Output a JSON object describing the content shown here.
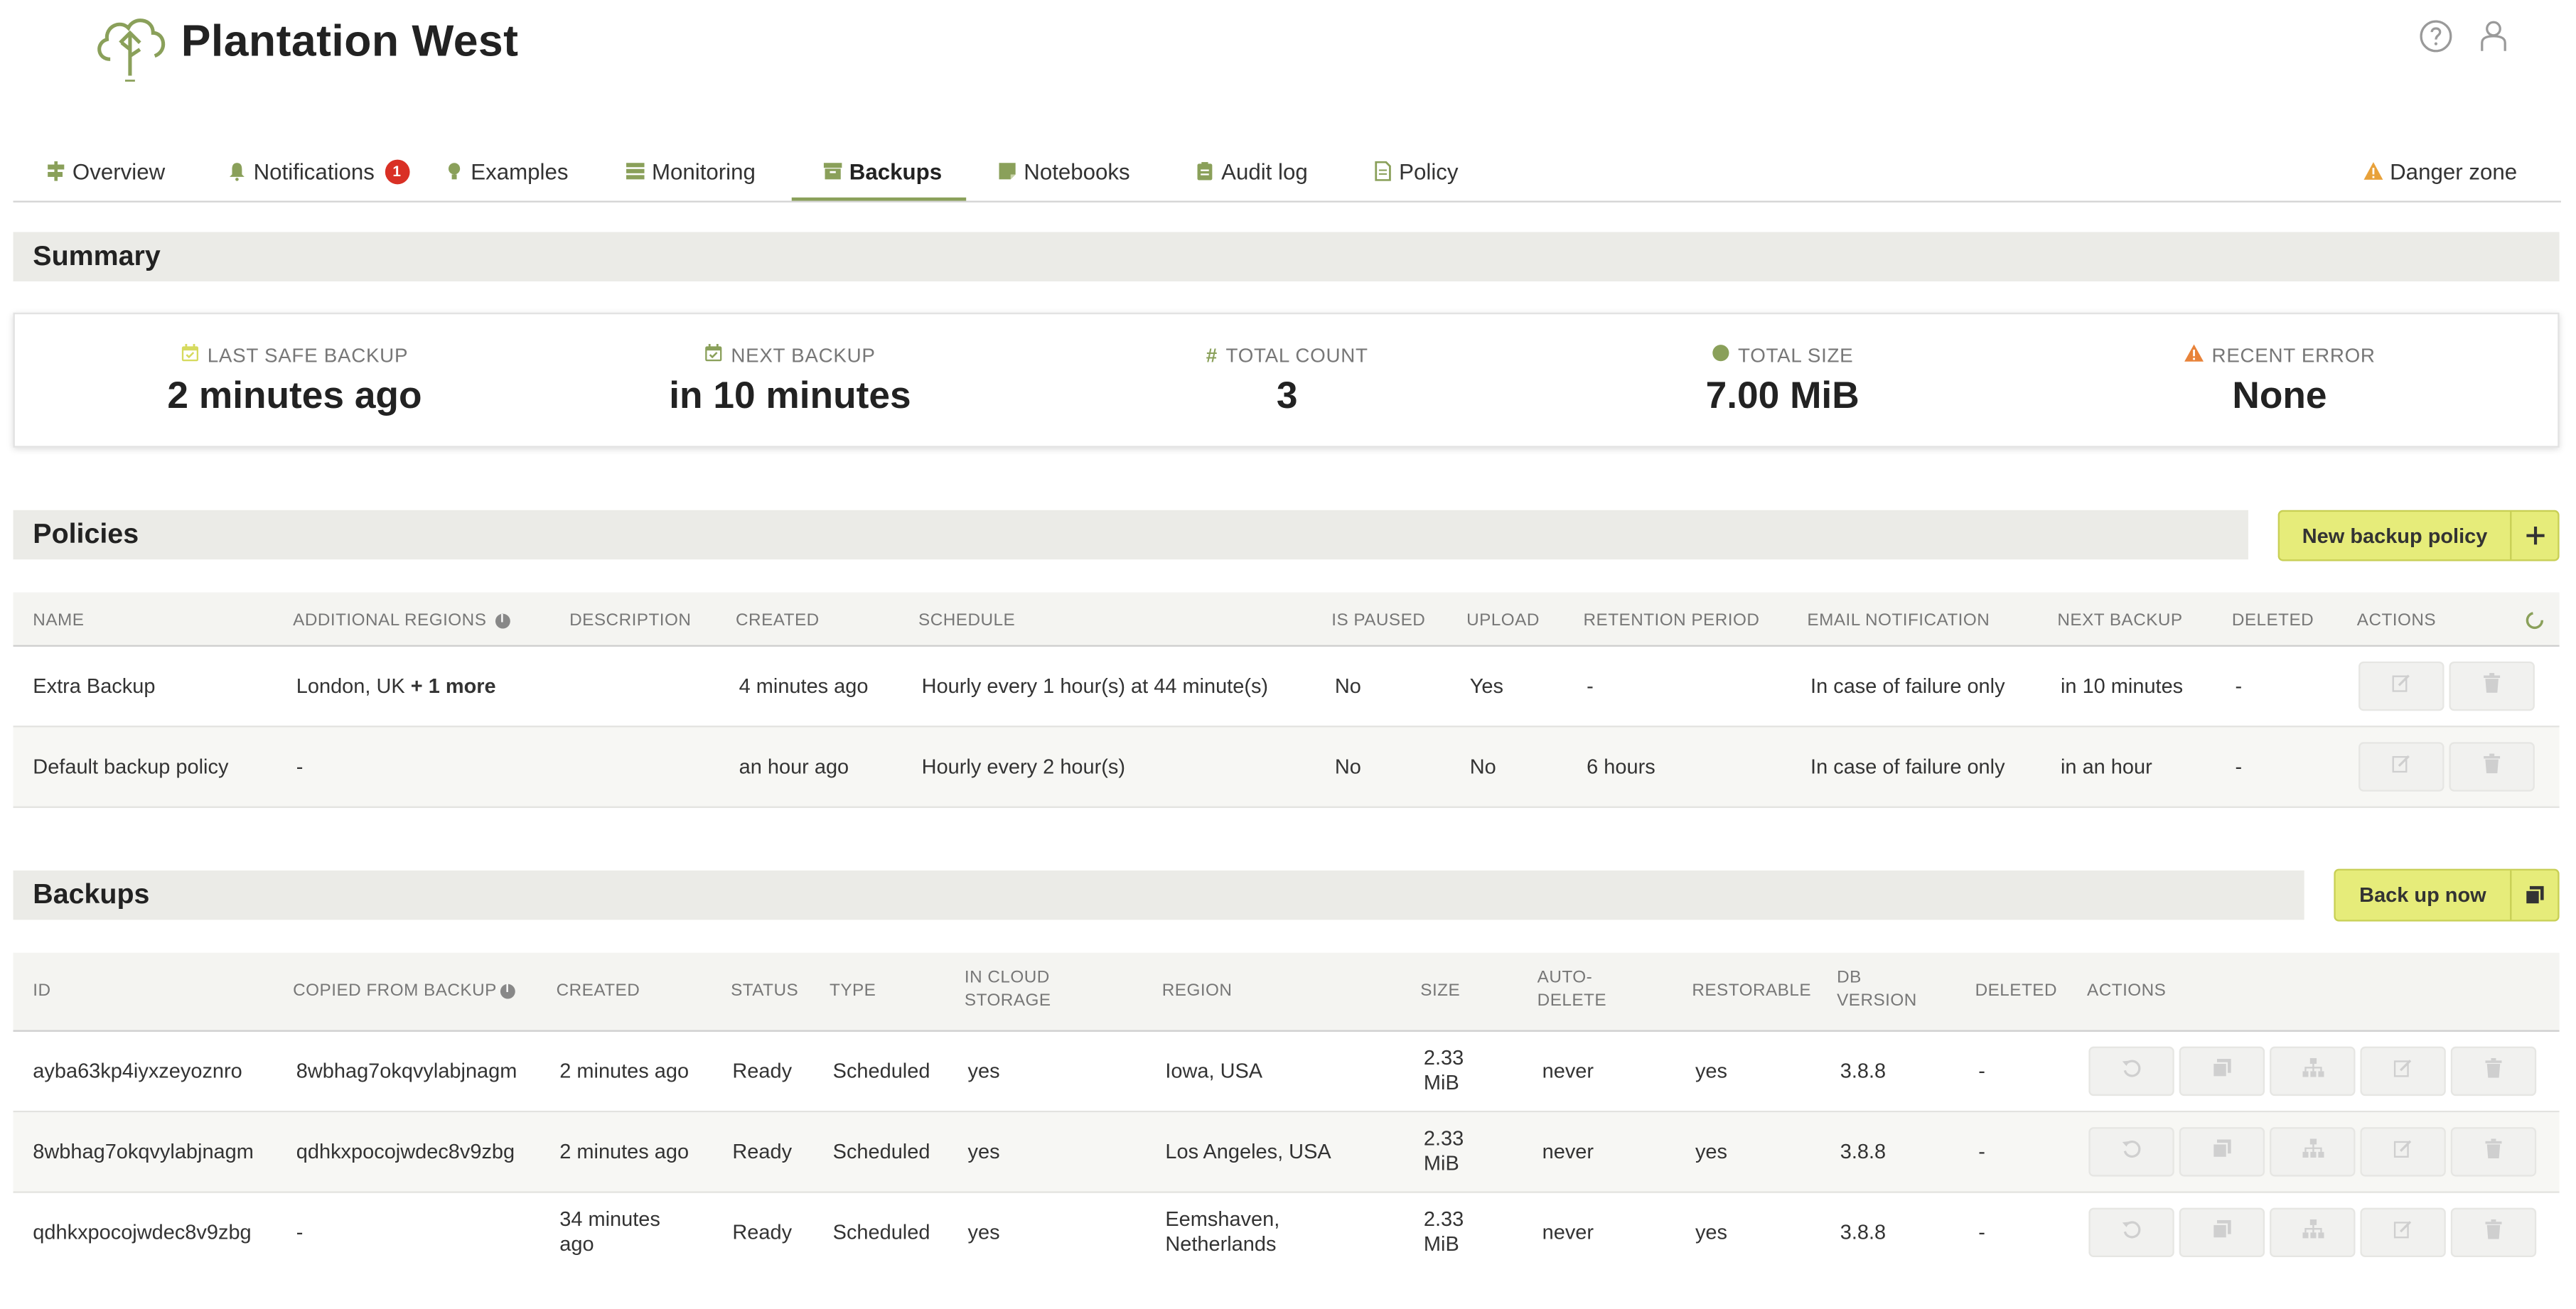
{
  "app": {
    "title": "Plantation West"
  },
  "tabs": [
    {
      "label": "Overview",
      "icon": "signpost-icon"
    },
    {
      "label": "Notifications",
      "icon": "bell-icon",
      "badge": "1"
    },
    {
      "label": "Examples",
      "icon": "lightbulb-icon"
    },
    {
      "label": "Monitoring",
      "icon": "server-icon"
    },
    {
      "label": "Backups",
      "icon": "archive-icon",
      "active": true
    },
    {
      "label": "Notebooks",
      "icon": "notebook-icon"
    },
    {
      "label": "Audit log",
      "icon": "clipboard-icon"
    },
    {
      "label": "Policy",
      "icon": "document-icon"
    },
    {
      "label": "Danger zone",
      "icon": "warning-icon"
    }
  ],
  "summary": {
    "title": "Summary",
    "stats": [
      {
        "label": "LAST SAFE BACKUP",
        "value": "2 minutes ago"
      },
      {
        "label": "NEXT BACKUP",
        "value": "in 10 minutes"
      },
      {
        "label": "TOTAL COUNT",
        "value": "3"
      },
      {
        "label": "TOTAL SIZE",
        "value": "7.00 MiB"
      },
      {
        "label": "RECENT ERROR",
        "value": "None"
      }
    ]
  },
  "policies": {
    "title": "Policies",
    "new_button": "New backup policy",
    "columns": [
      "NAME",
      "ADDITIONAL REGIONS",
      "DESCRIPTION",
      "CREATED",
      "SCHEDULE",
      "IS PAUSED",
      "UPLOAD",
      "RETENTION PERIOD",
      "EMAIL NOTIFICATION",
      "NEXT BACKUP",
      "DELETED",
      "ACTIONS"
    ],
    "rows": [
      {
        "name": "Extra Backup",
        "regions": "London, UK",
        "regions_more": "+ 1 more",
        "description": "",
        "created": "4 minutes ago",
        "schedule": "Hourly every 1 hour(s) at 44 minute(s)",
        "paused": "No",
        "upload": "Yes",
        "retention": "-",
        "email": "In case of failure only",
        "next": "in 10 minutes",
        "deleted": "-"
      },
      {
        "name": "Default backup policy",
        "regions": "-",
        "regions_more": "",
        "description": "",
        "created": "an hour ago",
        "schedule": "Hourly every 2 hour(s)",
        "paused": "No",
        "upload": "No",
        "retention": "6 hours",
        "email": "In case of failure only",
        "next": "in an hour",
        "deleted": "-"
      }
    ]
  },
  "backups": {
    "title": "Backups",
    "backup_button": "Back up now",
    "columns": [
      "ID",
      "COPIED FROM BACKUP",
      "CREATED",
      "STATUS",
      "TYPE",
      "IN CLOUD STORAGE",
      "REGION",
      "SIZE",
      "AUTO-DELETE",
      "RESTORABLE",
      "DB VERSION",
      "DELETED",
      "ACTIONS"
    ],
    "rows": [
      {
        "id": "ayba63kp4iyxzeyoznro",
        "copied": "8wbhag7okqvylabjnagm",
        "created": "2 minutes ago",
        "status": "Ready",
        "type": "Scheduled",
        "cloud": "yes",
        "region": "Iowa, USA",
        "size": "2.33 MiB",
        "autodelete": "never",
        "restorable": "yes",
        "dbversion": "3.8.8",
        "deleted": "-"
      },
      {
        "id": "8wbhag7okqvylabjnagm",
        "copied": "qdhkxpocojwdec8v9zbg",
        "created": "2 minutes ago",
        "status": "Ready",
        "type": "Scheduled",
        "cloud": "yes",
        "region": "Los Angeles, USA",
        "size": "2.33 MiB",
        "autodelete": "never",
        "restorable": "yes",
        "dbversion": "3.8.8",
        "deleted": "-"
      },
      {
        "id": "qdhkxpocojwdec8v9zbg",
        "copied": "-",
        "created": "34 minutes ago",
        "status": "Ready",
        "type": "Scheduled",
        "cloud": "yes",
        "region": "Eemshaven, Netherlands",
        "size": "2.33 MiB",
        "autodelete": "never",
        "restorable": "yes",
        "dbversion": "3.8.8",
        "deleted": "-"
      }
    ]
  },
  "colors": {
    "accent": "#8aa05a",
    "button_yellow": "#e6ec7a",
    "badge_red": "#d93025",
    "warning": "#e8833a"
  }
}
